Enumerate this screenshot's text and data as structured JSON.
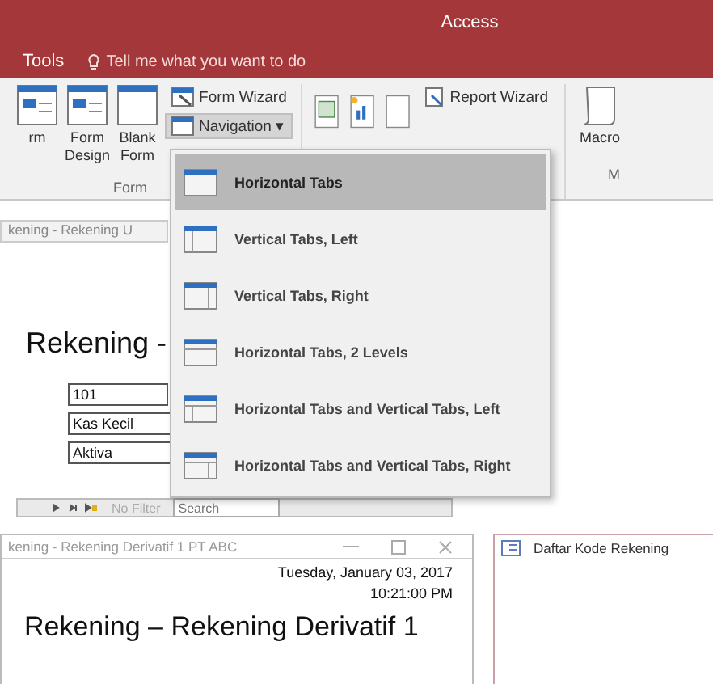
{
  "window": {
    "title": "Access"
  },
  "ribbon_tabs": [
    {
      "label": "Tools"
    }
  ],
  "tell_me": {
    "placeholder": "Tell me what you want to do"
  },
  "ribbon": {
    "forms": {
      "large_buttons": [
        {
          "label": "rm"
        },
        {
          "label": "Form Design"
        },
        {
          "label": "Blank Form"
        }
      ],
      "small_buttons": [
        {
          "label": "Form Wizard",
          "kind": "wizard",
          "selected": false
        },
        {
          "label": "Navigation ▾",
          "kind": "navigation",
          "selected": true
        }
      ],
      "group_label": "Form"
    },
    "reports": {
      "small_buttons": [
        {
          "label": "Report Wizard"
        }
      ]
    },
    "macro": {
      "label": "Macro",
      "group_label": "M"
    }
  },
  "navigation_menu": {
    "items": [
      {
        "label": "Horizontal Tabs",
        "selected": true
      },
      {
        "label": "Vertical Tabs, Left",
        "selected": false
      },
      {
        "label": "Vertical Tabs, Right",
        "selected": false
      },
      {
        "label": "Horizontal Tabs, 2 Levels",
        "selected": false
      },
      {
        "label": "Horizontal Tabs and Vertical Tabs, Left",
        "selected": false
      },
      {
        "label": "Horizontal Tabs and Vertical Tabs, Right",
        "selected": false
      }
    ]
  },
  "form_window": {
    "tab": "kening - Rekening U",
    "title": "Rekening -",
    "fields": [
      "101",
      "Kas Kecil",
      "Aktiva"
    ],
    "record_nav": {
      "filter": "No Filter",
      "placeholder": "Search"
    }
  },
  "report_window": {
    "title": "kening - Rekening Derivatif 1 PT ABC",
    "date": "Tuesday, January 03, 2017",
    "time": "10:21:00 PM",
    "heading": "Rekening – Rekening Derivatif 1"
  },
  "list_window": {
    "title": "Daftar Kode Rekening"
  }
}
